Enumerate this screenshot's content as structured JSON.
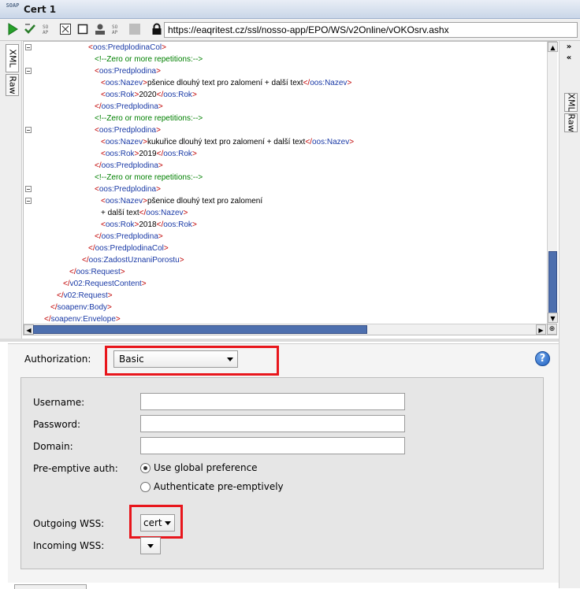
{
  "window": {
    "logo": "SOAP",
    "title": "Cert 1"
  },
  "toolbar": {
    "url": "https://eaqritest.cz/ssl/nosso-app/EPO/WS/v2Online/vOKOsrv.ashx",
    "icons": [
      "play-icon",
      "validate-icon",
      "soap-generate-icon",
      "frame-icon",
      "stop-square-icon",
      "user-icon",
      "soap-generate-icon",
      "stop-icon",
      "lock-icon"
    ]
  },
  "side_tabs": {
    "left": [
      "XML",
      "Raw"
    ],
    "right": [
      "XML",
      "Raw"
    ]
  },
  "editor": {
    "lines": [
      {
        "indent": 70,
        "parts": [
          [
            "tagred",
            "<"
          ],
          [
            "tagname",
            "oos:PredplodinaCol"
          ],
          [
            "tagred",
            ">"
          ]
        ]
      },
      {
        "indent": 78,
        "parts": [
          [
            "cm",
            "<!--Zero or more repetitions:-->"
          ]
        ]
      },
      {
        "indent": 78,
        "parts": [
          [
            "tagred",
            "<"
          ],
          [
            "tagname",
            "oos:Predplodina"
          ],
          [
            "tagred",
            ">"
          ]
        ]
      },
      {
        "indent": 86,
        "parts": [
          [
            "tagred",
            "<"
          ],
          [
            "tagname",
            "oos:Nazev"
          ],
          [
            "tagred",
            ">"
          ],
          [
            "txt",
            "pšenice dlouhý text pro zalomení + další text"
          ],
          [
            "tagred",
            "</"
          ],
          [
            "tagname",
            "oos:Nazev"
          ],
          [
            "tagred",
            ">"
          ]
        ]
      },
      {
        "indent": 86,
        "parts": [
          [
            "tagred",
            "<"
          ],
          [
            "tagname",
            "oos:Rok"
          ],
          [
            "tagred",
            ">"
          ],
          [
            "txt",
            "2020"
          ],
          [
            "tagred",
            "</"
          ],
          [
            "tagname",
            "oos:Rok"
          ],
          [
            "tagred",
            ">"
          ]
        ]
      },
      {
        "indent": 78,
        "parts": [
          [
            "tagred",
            "</"
          ],
          [
            "tagname",
            "oos:Predplodina"
          ],
          [
            "tagred",
            ">"
          ]
        ]
      },
      {
        "indent": 78,
        "parts": [
          [
            "cm",
            "<!--Zero or more repetitions:-->"
          ]
        ]
      },
      {
        "indent": 78,
        "parts": [
          [
            "tagred",
            "<"
          ],
          [
            "tagname",
            "oos:Predplodina"
          ],
          [
            "tagred",
            ">"
          ]
        ]
      },
      {
        "indent": 86,
        "parts": [
          [
            "tagred",
            "<"
          ],
          [
            "tagname",
            "oos:Nazev"
          ],
          [
            "tagred",
            ">"
          ],
          [
            "txt",
            "kukuřice dlouhý text pro zalomení + další text"
          ],
          [
            "tagred",
            "</"
          ],
          [
            "tagname",
            "oos:Nazev"
          ],
          [
            "tagred",
            ">"
          ]
        ]
      },
      {
        "indent": 86,
        "parts": [
          [
            "tagred",
            "<"
          ],
          [
            "tagname",
            "oos:Rok"
          ],
          [
            "tagred",
            ">"
          ],
          [
            "txt",
            "2019"
          ],
          [
            "tagred",
            "</"
          ],
          [
            "tagname",
            "oos:Rok"
          ],
          [
            "tagred",
            ">"
          ]
        ]
      },
      {
        "indent": 78,
        "parts": [
          [
            "tagred",
            "</"
          ],
          [
            "tagname",
            "oos:Predplodina"
          ],
          [
            "tagred",
            ">"
          ]
        ]
      },
      {
        "indent": 78,
        "parts": [
          [
            "cm",
            "<!--Zero or more repetitions:-->"
          ]
        ]
      },
      {
        "indent": 78,
        "parts": [
          [
            "tagred",
            "<"
          ],
          [
            "tagname",
            "oos:Predplodina"
          ],
          [
            "tagred",
            ">"
          ]
        ]
      },
      {
        "indent": 86,
        "parts": [
          [
            "tagred",
            "<"
          ],
          [
            "tagname",
            "oos:Nazev"
          ],
          [
            "tagred",
            ">"
          ],
          [
            "txt",
            "pšenice dlouhý text pro zalomení"
          ]
        ]
      },
      {
        "indent": 86,
        "parts": [
          [
            "txt",
            "+ další text"
          ],
          [
            "tagred",
            "</"
          ],
          [
            "tagname",
            "oos:Nazev"
          ],
          [
            "tagred",
            ">"
          ]
        ]
      },
      {
        "indent": 86,
        "parts": [
          [
            "tagred",
            "<"
          ],
          [
            "tagname",
            "oos:Rok"
          ],
          [
            "tagred",
            ">"
          ],
          [
            "txt",
            "2018"
          ],
          [
            "tagred",
            "</"
          ],
          [
            "tagname",
            "oos:Rok"
          ],
          [
            "tagred",
            ">"
          ]
        ]
      },
      {
        "indent": 78,
        "parts": [
          [
            "tagred",
            "</"
          ],
          [
            "tagname",
            "oos:Predplodina"
          ],
          [
            "tagred",
            ">"
          ]
        ]
      },
      {
        "indent": 70,
        "parts": [
          [
            "tagred",
            "</"
          ],
          [
            "tagname",
            "oos:PredplodinaCol"
          ],
          [
            "tagred",
            ">"
          ]
        ]
      },
      {
        "indent": 62,
        "parts": [
          [
            "tagred",
            "</"
          ],
          [
            "tagname",
            "oos:ZadostUznaniPorostu"
          ],
          [
            "tagred",
            ">"
          ]
        ]
      },
      {
        "indent": 46,
        "parts": [
          [
            "tagred",
            "</"
          ],
          [
            "tagname",
            "oos:Request"
          ],
          [
            "tagred",
            ">"
          ]
        ]
      },
      {
        "indent": 38,
        "parts": [
          [
            "tagred",
            "</"
          ],
          [
            "tagname",
            "v02:RequestContent"
          ],
          [
            "tagred",
            ">"
          ]
        ]
      },
      {
        "indent": 30,
        "parts": [
          [
            "tagred",
            "</"
          ],
          [
            "tagname",
            "v02:Request"
          ],
          [
            "tagred",
            ">"
          ]
        ]
      },
      {
        "indent": 22,
        "parts": [
          [
            "tagred",
            "</"
          ],
          [
            "tagname",
            "soapenv:Body"
          ],
          [
            "tagred",
            ">"
          ]
        ]
      },
      {
        "indent": 14,
        "parts": [
          [
            "tagred",
            "</"
          ],
          [
            "tagname",
            "soapenv:Envelope"
          ],
          [
            "tagred",
            ">"
          ]
        ]
      }
    ]
  },
  "auth": {
    "label": "Authorization:",
    "selected": "Basic",
    "help": "?",
    "username_label": "Username:",
    "username_value": "",
    "password_label": "Password:",
    "password_value": "",
    "domain_label": "Domain:",
    "domain_value": "",
    "preemptive_label": "Pre-emptive auth:",
    "option_global": "Use global preference",
    "option_preemptive": "Authenticate pre-emptively",
    "outgoing_label": "Outgoing WSS:",
    "outgoing_value": "cert",
    "incoming_label": "Incoming WSS:",
    "incoming_value": ""
  },
  "colors": {
    "highlight": "#e8161c",
    "scroll_thumb": "#4d6fae",
    "tag": "#c00000",
    "tagname": "#1a3aa6",
    "comment": "#008000"
  }
}
